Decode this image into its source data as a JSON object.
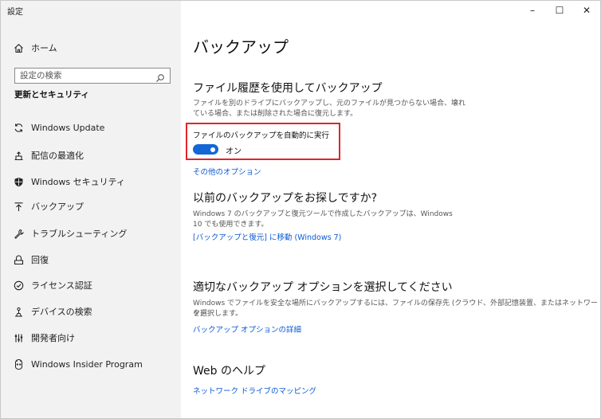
{
  "app": {
    "title": "設定"
  },
  "window_controls": {
    "minimize": "–",
    "maximize": "☐",
    "close": "✕"
  },
  "sidebar": {
    "home_label": "ホーム",
    "search_placeholder": "設定の検索",
    "section_title": "更新とセキュリティ",
    "items": [
      {
        "label": "Windows Update",
        "icon": "sync-icon"
      },
      {
        "label": "配信の最適化",
        "icon": "delivery-optimization-icon"
      },
      {
        "label": "Windows セキュリティ",
        "icon": "shield-icon"
      },
      {
        "label": "バックアップ",
        "icon": "backup-arrow-icon"
      },
      {
        "label": "トラブルシューティング",
        "icon": "wrench-icon"
      },
      {
        "label": "回復",
        "icon": "recovery-icon"
      },
      {
        "label": "ライセンス認証",
        "icon": "check-circle-icon"
      },
      {
        "label": "デバイスの検索",
        "icon": "find-device-icon"
      },
      {
        "label": "開発者向け",
        "icon": "developer-icon"
      },
      {
        "label": "Windows Insider Program",
        "icon": "insider-icon"
      }
    ]
  },
  "main": {
    "title": "バックアップ",
    "file_history": {
      "heading": "ファイル履歴を使用してバックアップ",
      "desc_line1": "ファイルを別のドライブにバックアップし、元のファイルが見つからない場合、壊れ",
      "desc_line2": "ている場合、または削除された場合に復元します。",
      "toggle_label": "ファイルのバックアップを自動的に実行",
      "toggle_state": "オン",
      "more_options": "その他のオプション"
    },
    "older_backup": {
      "heading": "以前のバックアップをお探しですか?",
      "desc_line1": "Windows 7 のバックアップと復元ツールで作成したバックアップは、Windows",
      "desc_line2": "10 でも使用できます。",
      "link": "[バックアップと復元] に移動 (Windows 7)"
    },
    "choose_option": {
      "heading": "適切なバックアップ オプションを選択してください",
      "desc_line1": "Windows でファイルを安全な場所にバックアップするには、ファイルの保存先 (クラウド、外部記憶装置、またはネットワーク)",
      "desc_line2": "を選択します。",
      "link": "バックアップ オプションの詳細"
    },
    "web_help": {
      "heading": "Web のヘルプ",
      "link": "ネットワーク ドライブのマッピング"
    }
  },
  "colors": {
    "accent": "#1466d6",
    "link": "#0b5ad6",
    "highlight": "#e0242b"
  }
}
